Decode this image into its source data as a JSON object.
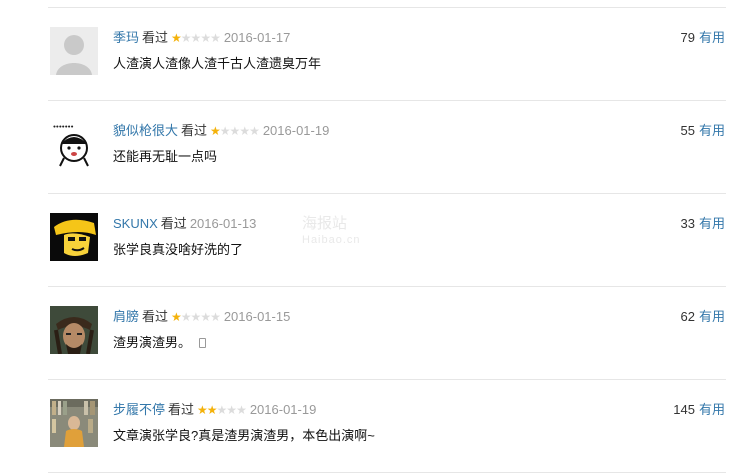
{
  "comments": [
    {
      "author": "季玛",
      "status": "看过",
      "stars": 1,
      "date": "2016-01-17",
      "text": "人渣演人渣像人渣千古人渣遗臭万年",
      "votes": "79",
      "vote_label": "有用",
      "avatar": "default-avatar"
    },
    {
      "author": "貌似枪很大",
      "status": "看过",
      "stars": 1,
      "date": "2016-01-19",
      "text": "还能再无耻一点吗",
      "votes": "55",
      "vote_label": "有用",
      "avatar": "cartoon-face-avatar"
    },
    {
      "author": "SKUNX",
      "status": "看过",
      "stars": 0,
      "date": "2016-01-13",
      "text": "张学良真没啥好洗的了",
      "votes": "33",
      "vote_label": "有用",
      "avatar": "yellow-cartoon-avatar"
    },
    {
      "author": "肩膀",
      "status": "看过",
      "stars": 1,
      "date": "2016-01-15",
      "text": "渣男演渣男。",
      "votes": "62",
      "vote_label": "有用",
      "avatar": "pirate-avatar",
      "mobile": true
    },
    {
      "author": "步履不停",
      "status": "看过",
      "stars": 2,
      "date": "2016-01-19",
      "text": "文章演张学良?真是渣男演渣男，本色出演啊~",
      "votes": "145",
      "vote_label": "有用",
      "avatar": "bookshelf-avatar"
    }
  ],
  "watermark": {
    "main": "海报站",
    "sub": "Haibao.cn"
  },
  "colors": {
    "link": "#3377aa",
    "star": "#f4b20b",
    "date": "#999999",
    "divider": "#e6e6e6"
  }
}
